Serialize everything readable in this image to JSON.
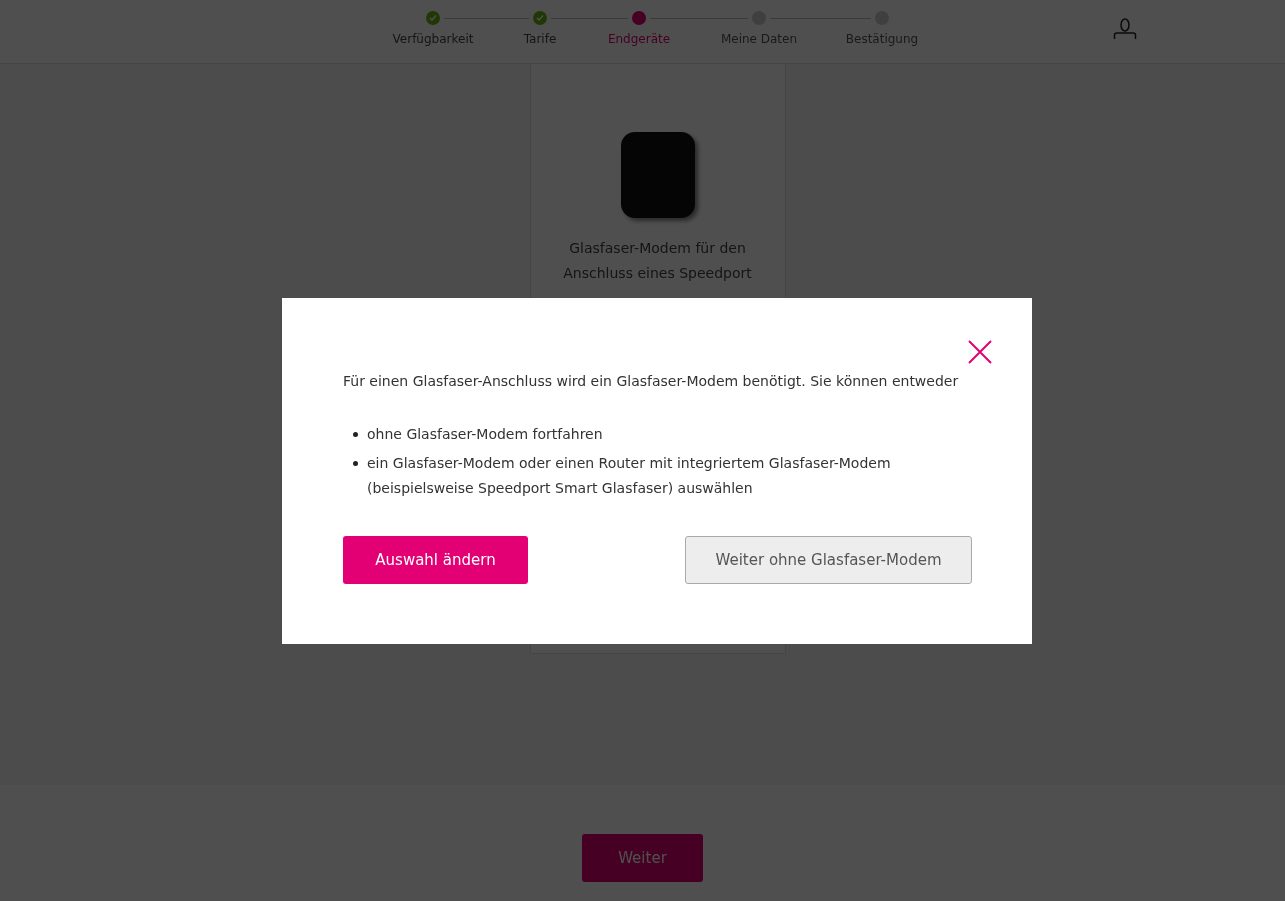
{
  "stepper": [
    {
      "label": "Verfügbarkeit",
      "done": true,
      "selected": false
    },
    {
      "label": "Tarife",
      "done": true,
      "selected": false
    },
    {
      "label": "Endgeräte",
      "done": false,
      "selected": true
    },
    {
      "label": "Meine Daten",
      "done": false,
      "selected": false
    },
    {
      "label": "Bestätigung",
      "done": false,
      "selected": false
    }
  ],
  "product_card": {
    "description": "Glasfaser-Modem für den Anschluss eines Speedport"
  },
  "footer": {
    "button": "Weiter"
  },
  "dialog": {
    "message": "Für einen Glasfaser-Anschluss wird ein Glasfaser-Modem benötigt. Sie können entweder",
    "options": [
      "ohne Glasfaser-Modem fortfahren",
      "ein Glasfaser-Modem oder einen Router mit integriertem Glasfaser-Modem (beispielsweise Speedport Smart Glasfaser) auswählen"
    ],
    "buttons": [
      {
        "label": "Auswahl ändern",
        "kind": "primary"
      },
      {
        "label": "Weiter ohne Glasfaser-Modem",
        "kind": "secondary"
      }
    ]
  }
}
